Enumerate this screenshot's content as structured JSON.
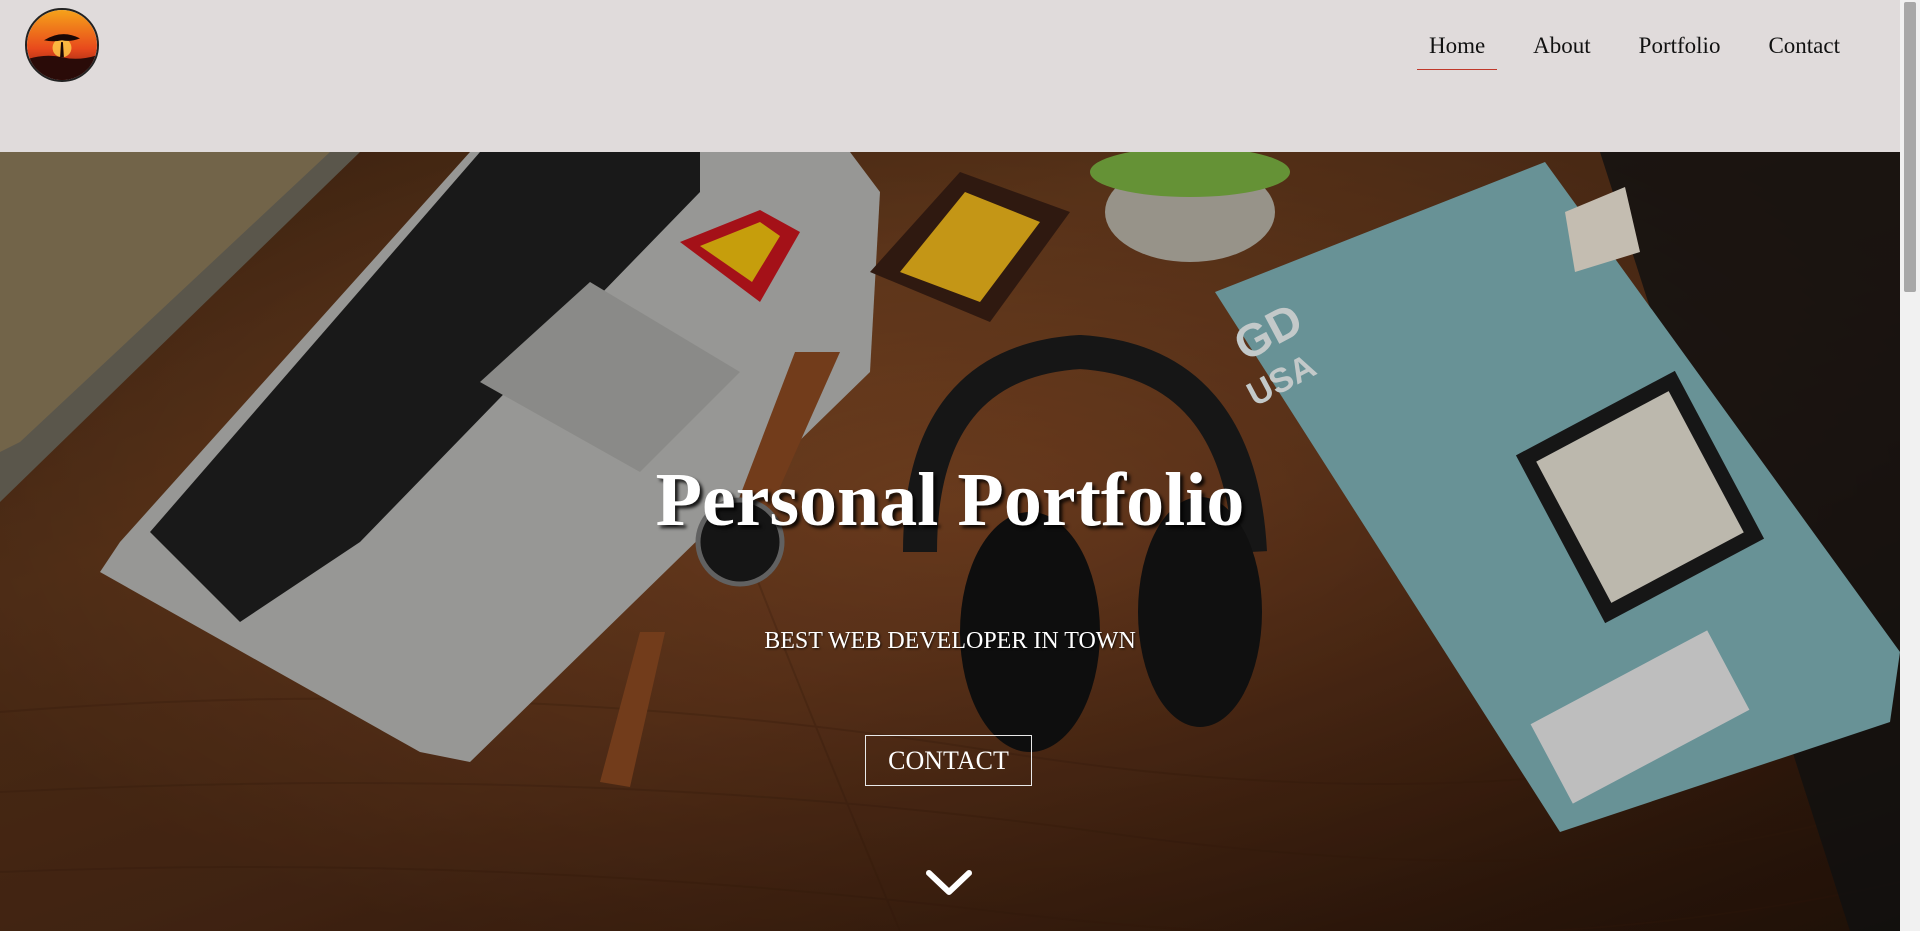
{
  "brand": {
    "logo_icon": "sunset-tree-logo-icon"
  },
  "nav": {
    "items": [
      {
        "label": "Home",
        "active": true
      },
      {
        "label": "About",
        "active": false
      },
      {
        "label": "Portfolio",
        "active": false
      },
      {
        "label": "Contact",
        "active": false
      }
    ],
    "active_underline_color": "#c0392b"
  },
  "hero": {
    "title": "Personal Portfolio",
    "subtitle": "BEST WEB DEVELOPER IN TOWN",
    "cta_label": "CONTACT",
    "scroll_icon": "chevron-down-icon",
    "background_image": "desk-with-laptop-headphones-watch-magazine"
  },
  "colors": {
    "header_bg": "#e0dbdb",
    "text_light": "#ffffff"
  }
}
